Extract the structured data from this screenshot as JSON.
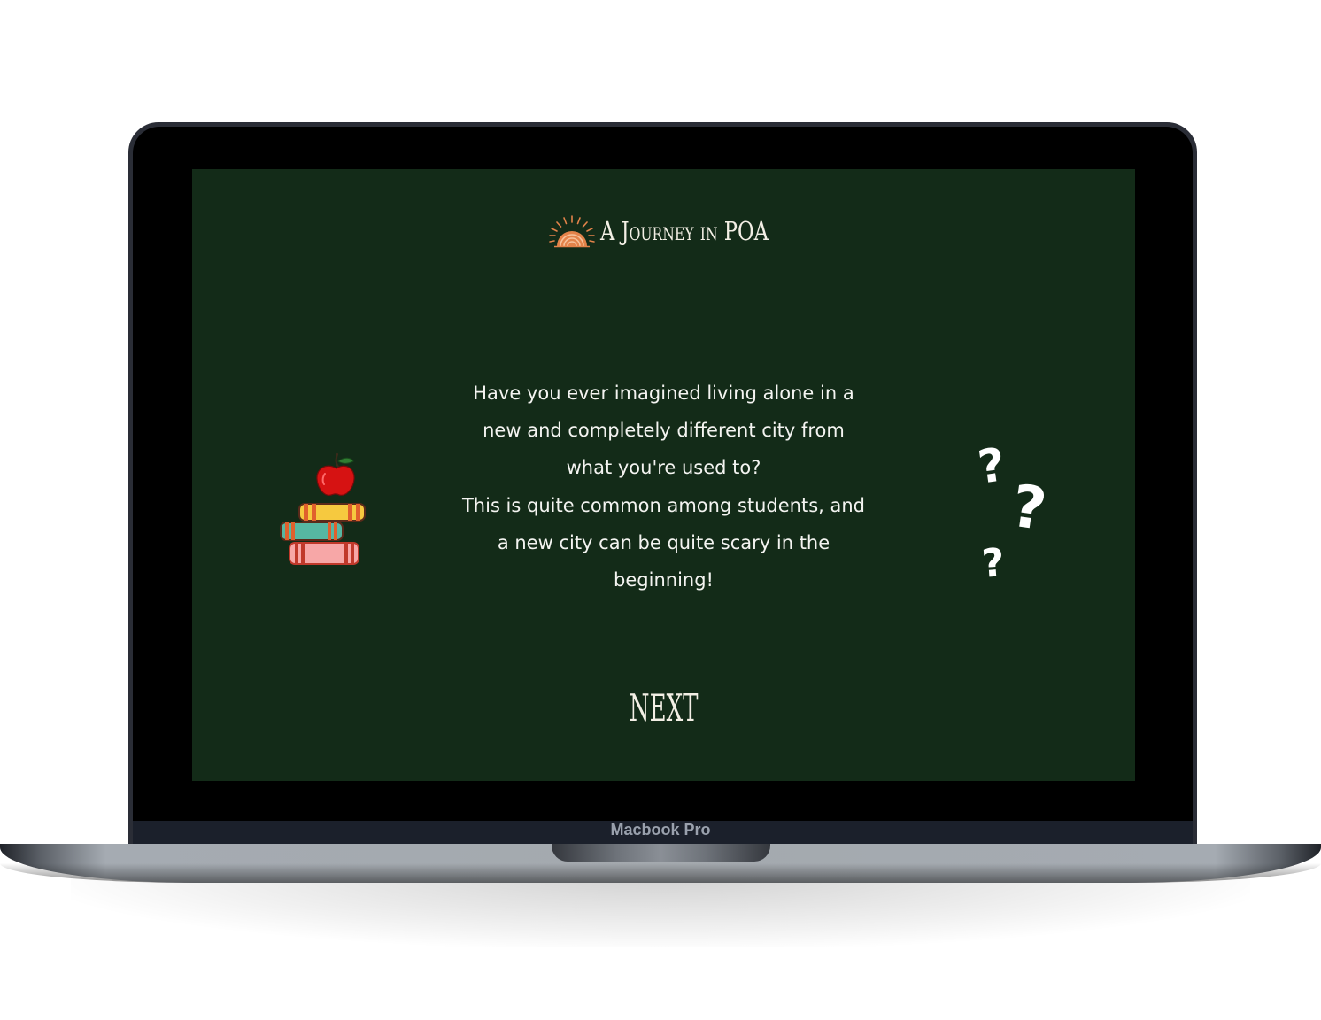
{
  "device": {
    "brand_label": "Macbook Pro"
  },
  "header": {
    "title": "A Journey in POA",
    "logo_icon": "sunrise-icon"
  },
  "main": {
    "lines": [
      "Have you ever imagined living alone in a",
      "new and completely different city from",
      "what you're used to?",
      "This is quite common among students, and",
      "a new city can be quite scary in the",
      "beginning!"
    ],
    "left_illustration": "books-apple-icon",
    "right_illustration": "question-marks-icon"
  },
  "question_marks": [
    "?",
    "?",
    "?"
  ],
  "navigation": {
    "next_label": "NEXT"
  },
  "colors": {
    "screen_bg": "#132b18",
    "text": "#f4f4f1",
    "accent_orange": "#e3834a"
  }
}
